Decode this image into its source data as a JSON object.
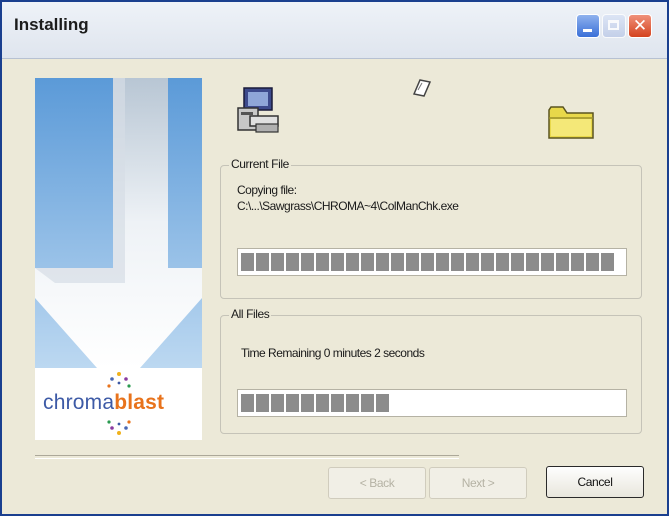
{
  "window": {
    "title": "Installing",
    "controls": [
      "minimize-icon",
      "maximize-icon",
      "close-icon"
    ],
    "close_glyph": "✕"
  },
  "branding": {
    "logo_part1": "chroma",
    "logo_part2": "blast",
    "logo_color1": "#3d5aa6",
    "logo_color2": "#e8731c"
  },
  "animation": {
    "icons": [
      "computer-icon",
      "flying-document-icon",
      "folder-icon"
    ]
  },
  "current_file": {
    "legend": "Current File",
    "status": "Copying file:",
    "path": "C:\\...\\Sawgrass\\CHROMA~4\\ColManChk.exe",
    "progress": 1.0
  },
  "all_files": {
    "legend": "All Files",
    "time_remaining": "Time Remaining 0 minutes 2 seconds",
    "progress": 0.4
  },
  "buttons": {
    "back": "< Back",
    "next": "Next >",
    "cancel": "Cancel"
  },
  "colors": {
    "progress_block": "#8c8c8c",
    "title_bar": "#e3e8f0",
    "face": "#ece9d8"
  }
}
